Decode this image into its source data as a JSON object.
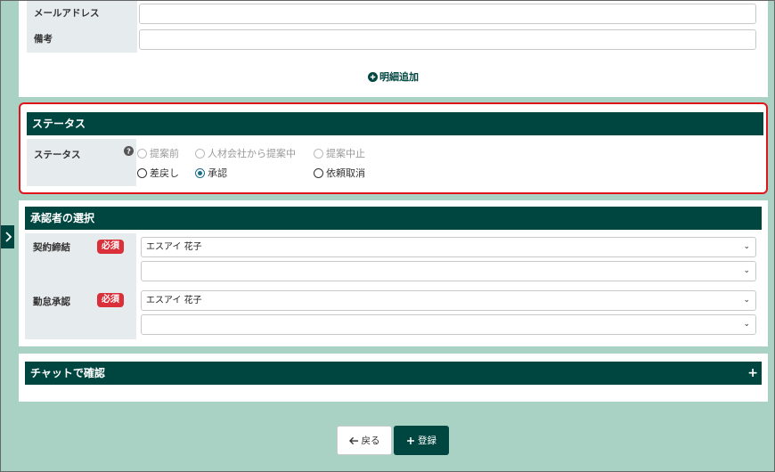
{
  "contact_section": {
    "email_label": "メールアドレス",
    "note_label": "備考",
    "add_detail_label": "明細追加"
  },
  "status_section": {
    "header": "ステータス",
    "field_label": "ステータス",
    "help_icon": "question-circle-icon",
    "options": [
      {
        "label": "提案前",
        "state": "disabled"
      },
      {
        "label": "人材会社から提案中",
        "state": "disabled"
      },
      {
        "label": "提案中止",
        "state": "disabled"
      },
      {
        "label": "差戻し",
        "state": "enabled"
      },
      {
        "label": "承認",
        "state": "checked"
      },
      {
        "label": "依頼取消",
        "state": "enabled"
      }
    ],
    "highlight_color": "#e0141b"
  },
  "approver_section": {
    "header": "承認者の選択",
    "rows": [
      {
        "label": "契約締結",
        "badge": "必須",
        "select1": "エスアイ 花子",
        "select2": ""
      },
      {
        "label": "勤怠承認",
        "badge": "必須",
        "select1": "エスアイ 花子",
        "select2": ""
      }
    ]
  },
  "chat_section": {
    "header": "チャットで確認",
    "expand_icon": "+"
  },
  "footer": {
    "back_label": "戻る",
    "register_label": "登録"
  },
  "colors": {
    "page_bg": "#a9d1c4",
    "header_bg": "#004640",
    "badge_red": "#d9303a"
  }
}
